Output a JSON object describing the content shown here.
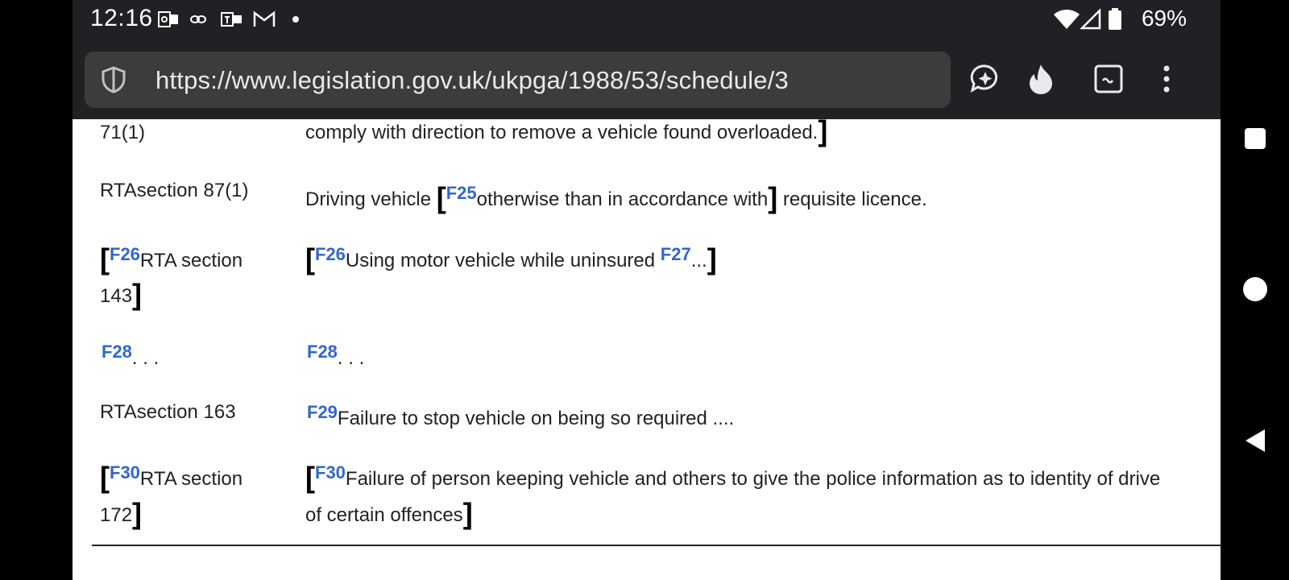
{
  "status_bar": {
    "time": "12:16",
    "battery": "69%",
    "icons": [
      "outlook-icon",
      "link-icon",
      "teams-icon",
      "gmail-icon",
      "dot-icon",
      "wifi-icon",
      "signal-icon",
      "battery-icon"
    ]
  },
  "browser": {
    "url": "https://www.legislation.gov.uk/ukpga/1988/53/schedule/3",
    "toolbar": [
      "assistant-icon",
      "flame-icon",
      "tab-switcher-icon",
      "more-menu-icon"
    ]
  },
  "table": {
    "rows": [
      {
        "left": "71(1)",
        "right_text": "comply with direction to remove a vehicle found overloaded.",
        "right_close": "]"
      },
      {
        "left": "RTAsection 87(1)",
        "right_pre": "Driving vehicle ",
        "right_open": "[",
        "right_ref": "F25",
        "right_mid": "otherwise than in accordance with",
        "right_close": "]",
        "right_post": " requisite licence."
      },
      {
        "left_open": "[",
        "left_ref": "F26",
        "left_text": "RTA section",
        "left_text2": "143",
        "left_close": "]",
        "right_open": "[",
        "right_ref": "F26",
        "right_text": "Using motor vehicle while uninsured ",
        "right_ref2": "F27",
        "right_dots": "...",
        "right_close": "]"
      },
      {
        "left_ref": "F28",
        "left_dots": ". . .",
        "right_ref": "F28",
        "right_dots": ". . ."
      },
      {
        "left": "RTAsection 163",
        "right_ref": "F29",
        "right_text": "Failure to stop vehicle on being so required ...."
      },
      {
        "left_open": "[",
        "left_ref": "F30",
        "left_text": "RTA section",
        "left_text2": "172",
        "left_close": "]",
        "right_open": "[",
        "right_ref": "F30",
        "right_text": "Failure of person keeping vehicle and others to give the police information as to identity of drive",
        "right_text2": "of certain offences",
        "right_close": "]"
      }
    ]
  },
  "nav": [
    "recents-button",
    "home-button",
    "back-button"
  ]
}
